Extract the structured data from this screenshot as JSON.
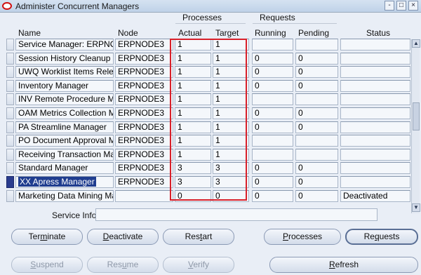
{
  "window": {
    "title": "Administer Concurrent Managers",
    "controls": [
      "-",
      "□",
      "×"
    ]
  },
  "table": {
    "group_headers": {
      "processes": "Processes",
      "requests": "Requests"
    },
    "columns": {
      "name": "Name",
      "node": "Node",
      "actual": "Actual",
      "target": "Target",
      "running": "Running",
      "pending": "Pending",
      "status": "Status"
    },
    "rows": [
      {
        "name": "Service Manager: ERPNODE",
        "node": "ERPNODE3",
        "actual": "1",
        "target": "1",
        "running": "",
        "pending": "",
        "status": ""
      },
      {
        "name": "Session History Cleanup",
        "node": "ERPNODE3",
        "actual": "1",
        "target": "1",
        "running": "0",
        "pending": "0",
        "status": ""
      },
      {
        "name": "UWQ Worklist Items Release",
        "node": "ERPNODE3",
        "actual": "1",
        "target": "1",
        "running": "0",
        "pending": "0",
        "status": ""
      },
      {
        "name": "Inventory Manager",
        "node": "ERPNODE3",
        "actual": "1",
        "target": "1",
        "running": "0",
        "pending": "0",
        "status": ""
      },
      {
        "name": "INV Remote Procedure Mana",
        "node": "ERPNODE3",
        "actual": "1",
        "target": "1",
        "running": "",
        "pending": "",
        "status": ""
      },
      {
        "name": "OAM Metrics Collection Man",
        "node": "ERPNODE3",
        "actual": "1",
        "target": "1",
        "running": "0",
        "pending": "0",
        "status": ""
      },
      {
        "name": "PA Streamline Manager",
        "node": "ERPNODE3",
        "actual": "1",
        "target": "1",
        "running": "0",
        "pending": "0",
        "status": ""
      },
      {
        "name": "PO Document Approval Mana",
        "node": "ERPNODE3",
        "actual": "1",
        "target": "1",
        "running": "",
        "pending": "",
        "status": ""
      },
      {
        "name": "Receiving Transaction Manag",
        "node": "ERPNODE3",
        "actual": "1",
        "target": "1",
        "running": "",
        "pending": "",
        "status": ""
      },
      {
        "name": "Standard Manager",
        "node": "ERPNODE3",
        "actual": "3",
        "target": "3",
        "running": "0",
        "pending": "0",
        "status": ""
      },
      {
        "name": "XX Apress Manager",
        "node": "ERPNODE3",
        "actual": "3",
        "target": "3",
        "running": "0",
        "pending": "0",
        "status": ""
      },
      {
        "name": "Marketing Data Mining Mana",
        "node": "",
        "actual": "0",
        "target": "0",
        "running": "0",
        "pending": "0",
        "status": "Deactivated"
      }
    ],
    "selected_row_index": 10
  },
  "service_info": {
    "label": "Service Info",
    "value": ""
  },
  "buttons": {
    "terminate": {
      "before": "Ter",
      "key": "m",
      "after": "inate"
    },
    "deactivate": {
      "before": "",
      "key": "D",
      "after": "eactivate"
    },
    "restart": {
      "before": "Res",
      "key": "t",
      "after": "art"
    },
    "processes": {
      "before": "",
      "key": "P",
      "after": "rocesses"
    },
    "requests": {
      "before": "Re",
      "key": "q",
      "after": "uests"
    },
    "suspend": {
      "before": "",
      "key": "S",
      "after": "uspend"
    },
    "resume": {
      "before": "Res",
      "key": "u",
      "after": "me"
    },
    "verify": {
      "before": "",
      "key": "V",
      "after": "erify"
    },
    "refresh": {
      "before": "",
      "key": "R",
      "after": "efresh"
    }
  },
  "colors": {
    "highlight_box": "#d8202a",
    "selection": "#1f3d8f"
  }
}
